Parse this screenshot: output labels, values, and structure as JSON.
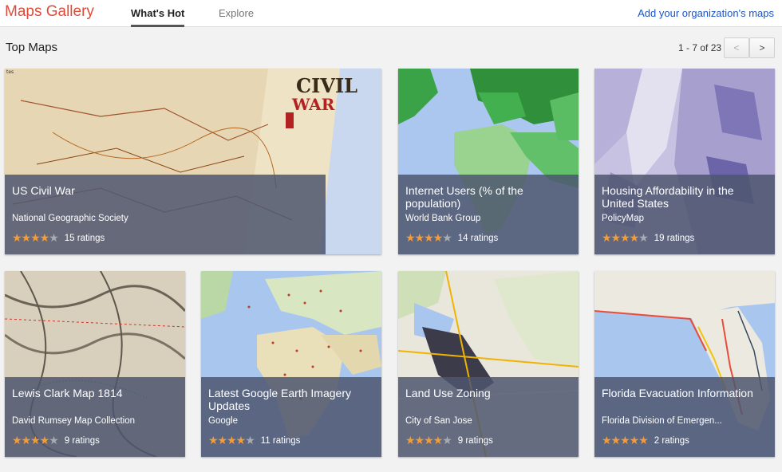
{
  "app": {
    "brand": "Maps Gallery",
    "add_link": "Add your organization's maps"
  },
  "tabs": [
    {
      "label": "What's Hot",
      "active": true
    },
    {
      "label": "Explore",
      "active": false
    }
  ],
  "section": {
    "title": "Top Maps"
  },
  "pager": {
    "range": "1 - 7 of 23",
    "prev": "<",
    "next": ">"
  },
  "cards": [
    {
      "title": "US Civil War",
      "publisher": "National Geographic Society",
      "ratings": "15 ratings",
      "stars": 4.5
    },
    {
      "title": "Internet Users (% of the population)",
      "publisher": "World Bank Group",
      "ratings": "14 ratings",
      "stars": 4.5
    },
    {
      "title": "Housing Affordability in the United States",
      "publisher": "PolicyMap",
      "ratings": "19 ratings",
      "stars": 4.5
    },
    {
      "title": "Lewis Clark Map 1814",
      "publisher": "David Rumsey Map Collection",
      "ratings": "9 ratings",
      "stars": 4.5
    },
    {
      "title": "Latest Google Earth Imagery Updates",
      "publisher": "Google",
      "ratings": "11 ratings",
      "stars": 4.5
    },
    {
      "title": "Land Use Zoning",
      "publisher": "City of San Jose",
      "ratings": "9 ratings",
      "stars": 4
    },
    {
      "title": "Florida Evacuation Information",
      "publisher": "Florida Division of Emergen...",
      "ratings": "2 ratings",
      "stars": 5
    }
  ],
  "colors": {
    "brand": "#dd4b39",
    "link": "#1a55c7",
    "star": "#f39c3a",
    "overlay": "#4e566e"
  }
}
